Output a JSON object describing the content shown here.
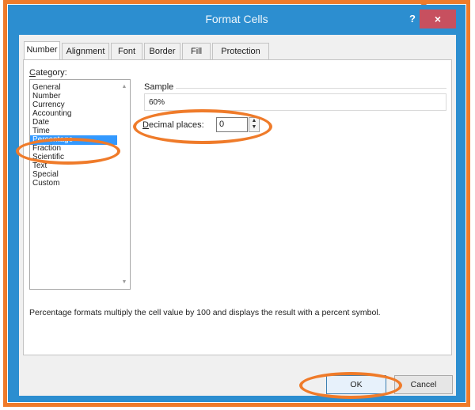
{
  "window": {
    "title": "Format Cells",
    "help_icon": "?",
    "close_icon": "×"
  },
  "tabs": [
    {
      "label": "Number",
      "active": true
    },
    {
      "label": "Alignment",
      "active": false
    },
    {
      "label": "Font",
      "active": false
    },
    {
      "label": "Border",
      "active": false
    },
    {
      "label": "Fill",
      "active": false
    },
    {
      "label": "Protection",
      "active": false
    }
  ],
  "category": {
    "label_prefix": "C",
    "label_rest": "ategory:",
    "items": [
      "General",
      "Number",
      "Currency",
      "Accounting",
      "Date",
      "Time",
      "Percentage",
      "Fraction",
      "Scientific",
      "Text",
      "Special",
      "Custom"
    ],
    "selected": "Percentage"
  },
  "sample": {
    "label": "Sample",
    "value": "60%"
  },
  "decimal_places": {
    "label_prefix": "D",
    "label_rest": "ecimal places:",
    "value": "0"
  },
  "description": "Percentage formats multiply the cell value by 100 and displays the result with a percent symbol.",
  "buttons": {
    "ok": "OK",
    "cancel": "Cancel"
  },
  "colors": {
    "titlebar": "#2c8ed0",
    "close_button": "#c7505f",
    "annotation": "#ef7b2a",
    "selection": "#3399ff"
  }
}
